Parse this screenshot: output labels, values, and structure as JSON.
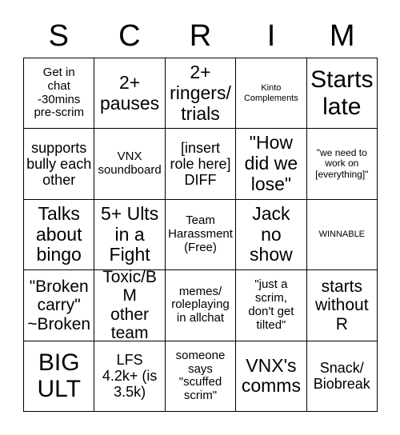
{
  "card": {
    "header_letters": [
      "S",
      "C",
      "R",
      "I",
      "M"
    ],
    "rows": [
      [
        {
          "text": "Get in\nchat\n-30mins\npre-scrim",
          "size": "sm"
        },
        {
          "text": "2+\npauses",
          "size": "xl"
        },
        {
          "text": "2+\nringers/\ntrials",
          "size": "xl"
        },
        {
          "text": "Kinto\nComplements",
          "size": "xxs"
        },
        {
          "text": "Starts\nlate",
          "size": "xxl"
        }
      ],
      [
        {
          "text": "supports\nbully each\nother",
          "size": "md"
        },
        {
          "text": "VNX\nsoundboard",
          "size": "sm"
        },
        {
          "text": "[insert\nrole here]\nDIFF",
          "size": "md"
        },
        {
          "text": "\"How\ndid we\nlose\"",
          "size": "xl"
        },
        {
          "text": "\"we need to\nwork on\n[everything]\"",
          "size": "xs"
        }
      ],
      [
        {
          "text": "Talks\nabout\nbingo",
          "size": "xl"
        },
        {
          "text": "5+ Ults\nin a\nFight",
          "size": "xl"
        },
        {
          "text": "Team\nHarassment\n(Free)",
          "size": "sm"
        },
        {
          "text": "Jack\nno\nshow",
          "size": "xl"
        },
        {
          "text": "WINNABLE",
          "size": "xxs"
        }
      ],
      [
        {
          "text": "\"Broken\ncarry\"\n~Broken",
          "size": "lg"
        },
        {
          "text": "Toxic/BM\nother\nteam",
          "size": "lg"
        },
        {
          "text": "memes/\nroleplaying\nin allchat",
          "size": "sm"
        },
        {
          "text": "\"just a\nscrim,\ndon't get\ntilted\"",
          "size": "sm"
        },
        {
          "text": "starts\nwithout\nR",
          "size": "lg"
        }
      ],
      [
        {
          "text": "BIG\nULT",
          "size": "xxl"
        },
        {
          "text": "LFS\n4.2k+ (is\n3.5k)",
          "size": "md"
        },
        {
          "text": "someone\nsays\n\"scuffed\nscrim\"",
          "size": "sm"
        },
        {
          "text": "VNX's\ncomms",
          "size": "xl"
        },
        {
          "text": "Snack/\nBiobreak",
          "size": "md"
        }
      ]
    ]
  }
}
